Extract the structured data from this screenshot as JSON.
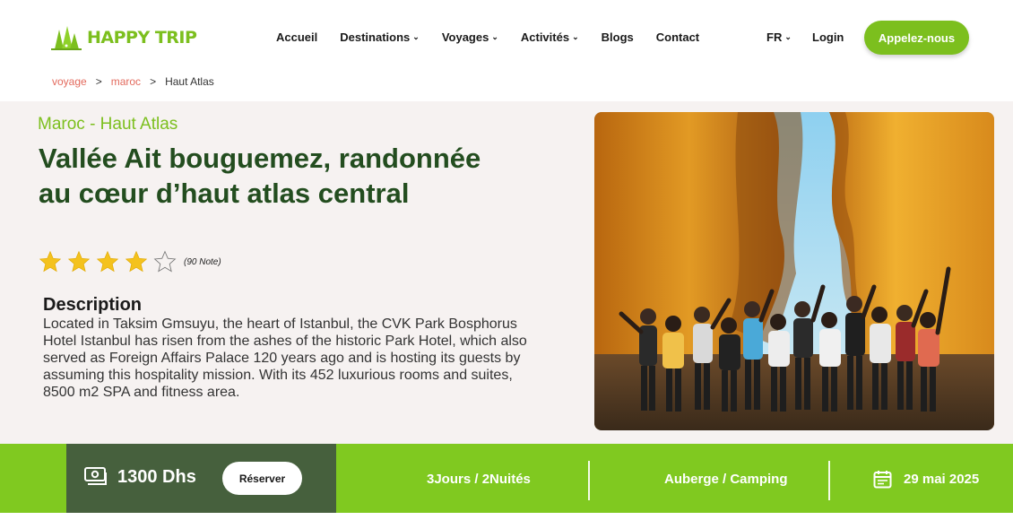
{
  "header": {
    "logo_text": "HAPPY TRIP",
    "nav": [
      {
        "label": "Accueil",
        "dropdown": false
      },
      {
        "label": "Destinations",
        "dropdown": true
      },
      {
        "label": "Voyages",
        "dropdown": true
      },
      {
        "label": "Activités",
        "dropdown": true
      },
      {
        "label": "Blogs",
        "dropdown": false
      },
      {
        "label": "Contact",
        "dropdown": false
      }
    ],
    "lang": "FR",
    "login": "Login",
    "call_button": "Appelez-nous"
  },
  "breadcrumb": {
    "items": [
      "voyage",
      "maroc"
    ],
    "current": "Haut Atlas"
  },
  "trip": {
    "subtitle": "Maroc - Haut Atlas",
    "title": "Vallée Ait bouguemez, randonnée au cœur d’haut atlas central",
    "rating": {
      "filled": 4,
      "total": 5,
      "note": "(90 Note)"
    },
    "description_title": "Description",
    "description": "Located in Taksim Gmsuyu, the heart of Istanbul, the CVK Park Bosphorus Hotel Istanbul has risen from the ashes of the historic Park Hotel, which also served as Foreign Affairs Palace 120 years ago and is hosting its guests by assuming this hospitality mission. With its 452 luxurious rooms and suites, 8500 m2 SPA and fitness area."
  },
  "booking": {
    "price": "1300 Dhs",
    "reserve_button": "Réserver",
    "duration": "3Jours / 2Nuités",
    "accommodation": "Auberge / Camping",
    "date": "29 mai 2025"
  },
  "colors": {
    "brand_green": "#7cbf1e",
    "bar_green": "#80c920",
    "dark_green": "#46603d",
    "title_green": "#234d1f",
    "breadcrumb_link": "#e36b5e"
  }
}
